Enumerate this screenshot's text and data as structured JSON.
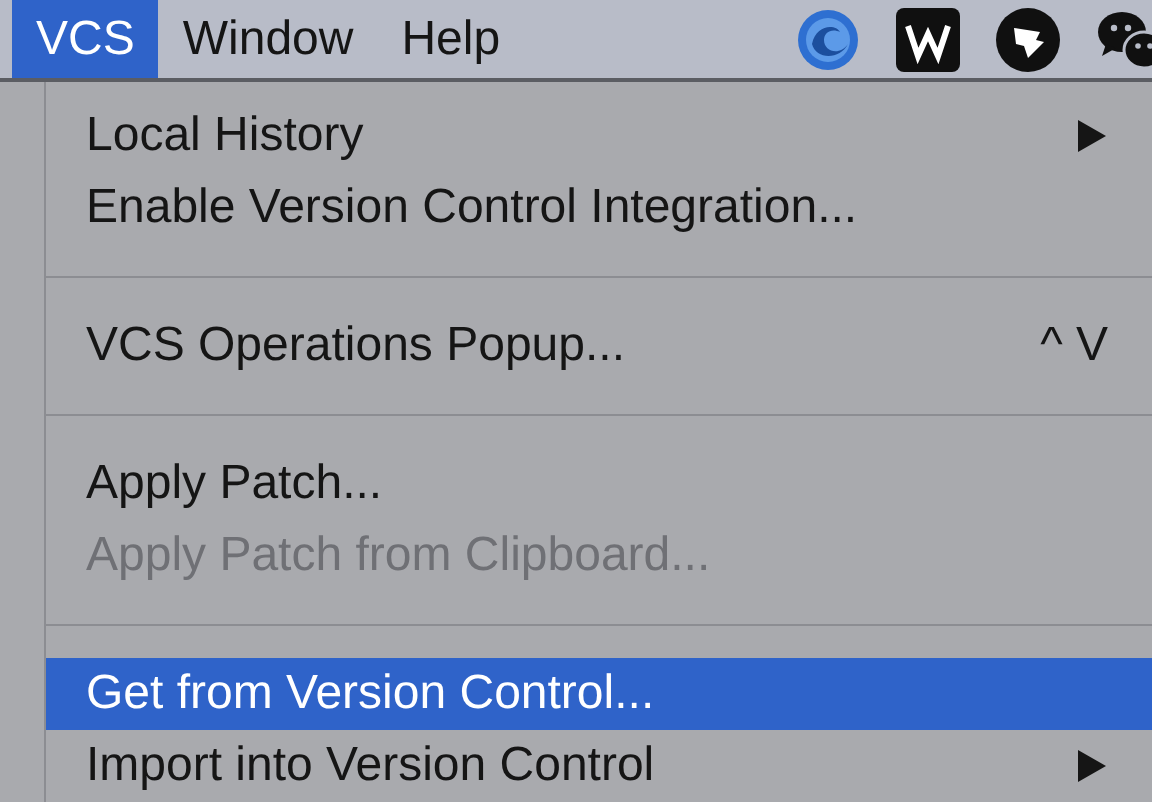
{
  "menu_bar": [
    {
      "label": "VCS",
      "selected": true
    },
    {
      "label": "Window",
      "selected": false
    },
    {
      "label": "Help",
      "selected": false
    }
  ],
  "menu": [
    {
      "kind": "item",
      "label": "Local History",
      "submenu": true,
      "disabled": false,
      "selected": false
    },
    {
      "kind": "item",
      "label": "Enable Version Control Integration...",
      "submenu": false,
      "disabled": false,
      "selected": false
    },
    {
      "kind": "separator"
    },
    {
      "kind": "item",
      "label": "VCS Operations Popup...",
      "shortcut": "^ V",
      "submenu": false,
      "disabled": false,
      "selected": false
    },
    {
      "kind": "separator"
    },
    {
      "kind": "item",
      "label": "Apply Patch...",
      "submenu": false,
      "disabled": false,
      "selected": false
    },
    {
      "kind": "item",
      "label": "Apply Patch from Clipboard...",
      "submenu": false,
      "disabled": true,
      "selected": false
    },
    {
      "kind": "separator"
    },
    {
      "kind": "item",
      "label": "Get from Version Control...",
      "submenu": false,
      "disabled": false,
      "selected": true
    },
    {
      "kind": "item",
      "label": "Import into Version Control",
      "submenu": true,
      "disabled": false,
      "selected": false
    }
  ]
}
